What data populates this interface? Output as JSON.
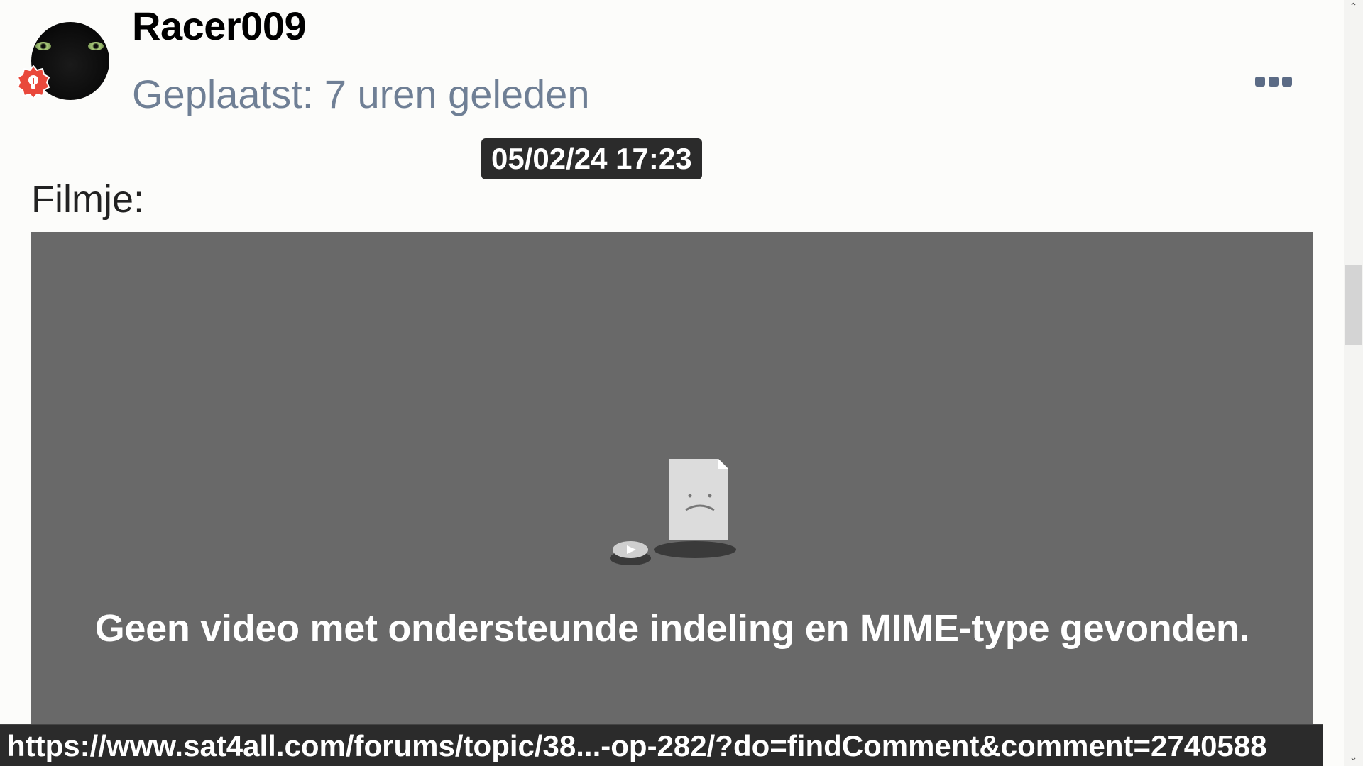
{
  "post": {
    "username": "Racer009",
    "posted_label": "Geplaatst: 7 uren geleden",
    "timestamp_tooltip": "05/02/24 17:23",
    "content_label": "Filmje:"
  },
  "video": {
    "error_message": "Geen video met ondersteunde indeling en MIME-type gevonden."
  },
  "statusbar": {
    "url": "https://www.sat4all.com/forums/topic/38...-op-282/?do=findComment&comment=2740588"
  },
  "icons": {
    "badge": "lightbulb-badge-icon",
    "more": "ellipsis-icon",
    "broken_file": "broken-file-icon"
  },
  "colors": {
    "posted_text": "#6f7f95",
    "badge": "#e9483b",
    "video_bg": "#696969"
  }
}
